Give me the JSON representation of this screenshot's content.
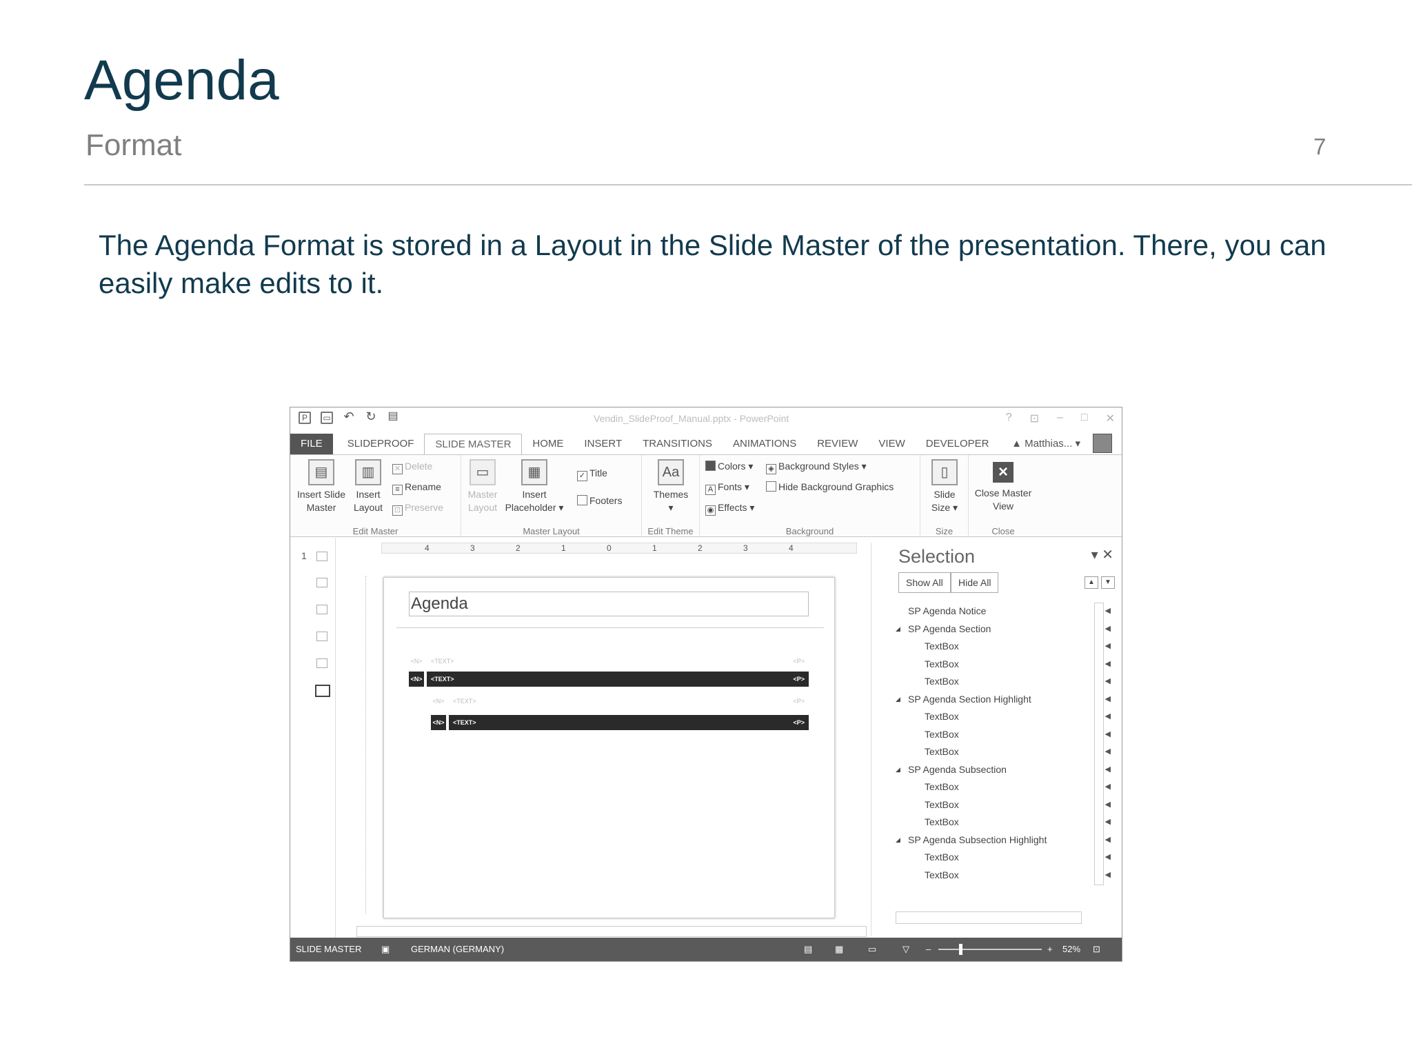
{
  "slide": {
    "title": "Agenda",
    "subtitle": "Format",
    "page_number": "7",
    "body": "The Agenda Format is stored in a Layout in the Slide Master of the presentation. There, you can easily make edits to it."
  },
  "screenshot": {
    "window_title": "Vendin_SlideProof_Manual.pptx - PowerPoint",
    "window_controls": [
      "?",
      "⊡",
      "–",
      "□",
      "✕"
    ],
    "tabs": [
      "FILE",
      "SLIDEPROOF",
      "SLIDE MASTER",
      "HOME",
      "INSERT",
      "TRANSITIONS",
      "ANIMATIONS",
      "REVIEW",
      "VIEW",
      "DEVELOPER"
    ],
    "active_tab": "SLIDE MASTER",
    "user": "Matthias...",
    "ribbon": {
      "edit_master": {
        "label": "Edit Master",
        "insert_slide_master": "Insert Slide Master",
        "insert_layout": "Insert Layout",
        "delete": "Delete",
        "rename": "Rename",
        "preserve": "Preserve"
      },
      "master_layout": {
        "label": "Master Layout",
        "master_layout_btn": "Master Layout",
        "insert_placeholder": "Insert Placeholder",
        "title": "Title",
        "footers": "Footers",
        "title_checked": true,
        "footers_checked": false
      },
      "edit_theme": {
        "label": "Edit Theme",
        "themes": "Themes"
      },
      "background": {
        "label": "Background",
        "colors": "Colors",
        "fonts": "Fonts",
        "effects": "Effects",
        "background_styles": "Background Styles",
        "hide_background_graphics": "Hide Background Graphics"
      },
      "size": {
        "label": "Size",
        "slide_size": "Slide Size"
      },
      "close": {
        "label": "Close",
        "close_master_view": "Close Master View"
      }
    },
    "ruler_marks": [
      "4",
      "3",
      "2",
      "1",
      "0",
      "1",
      "2",
      "3",
      "4"
    ],
    "thumbnail_number": "1",
    "layout": {
      "title": "Agenda",
      "rows": [
        {
          "num": "<N>",
          "text": "<TEXT>",
          "page": "<P>",
          "dark": false
        },
        {
          "num": "<N>",
          "text": "<TEXT>",
          "page": "<P>",
          "dark": true
        },
        {
          "num": "<N>",
          "text": "<TEXT>",
          "page": "<P>",
          "dark": false
        },
        {
          "num": "<N>",
          "text": "<TEXT>",
          "page": "<P>",
          "dark": true
        }
      ]
    },
    "selection_pane": {
      "title": "Selection",
      "show_all": "Show All",
      "hide_all": "Hide All",
      "items": [
        {
          "label": "SP Agenda Notice",
          "level": 0,
          "group": false
        },
        {
          "label": "SP Agenda Section",
          "level": 0,
          "group": true
        },
        {
          "label": "TextBox",
          "level": 1,
          "group": false
        },
        {
          "label": "TextBox",
          "level": 1,
          "group": false
        },
        {
          "label": "TextBox",
          "level": 1,
          "group": false
        },
        {
          "label": "SP Agenda Section Highlight",
          "level": 0,
          "group": true
        },
        {
          "label": "TextBox",
          "level": 1,
          "group": false
        },
        {
          "label": "TextBox",
          "level": 1,
          "group": false
        },
        {
          "label": "TextBox",
          "level": 1,
          "group": false
        },
        {
          "label": "SP Agenda Subsection",
          "level": 0,
          "group": true
        },
        {
          "label": "TextBox",
          "level": 1,
          "group": false
        },
        {
          "label": "TextBox",
          "level": 1,
          "group": false
        },
        {
          "label": "TextBox",
          "level": 1,
          "group": false
        },
        {
          "label": "SP Agenda Subsection Highlight",
          "level": 0,
          "group": true
        },
        {
          "label": "TextBox",
          "level": 1,
          "group": false
        },
        {
          "label": "TextBox",
          "level": 1,
          "group": false
        }
      ]
    },
    "status_bar": {
      "mode": "SLIDE MASTER",
      "language": "GERMAN (GERMANY)",
      "zoom": "52%"
    }
  }
}
